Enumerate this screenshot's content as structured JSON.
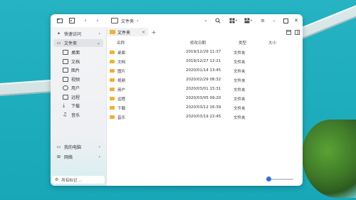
{
  "toolbar": {
    "address_path": "文件夹",
    "address_sep": "›"
  },
  "sidebar": {
    "items": [
      {
        "label": "快速访问",
        "icon": "star-icon"
      },
      {
        "label": "文件夹",
        "icon": "computer-icon"
      },
      {
        "label": "我的电脑",
        "icon": "monitor-icon"
      },
      {
        "label": "网络",
        "icon": "network-icon"
      }
    ],
    "subitems": [
      {
        "label": "桌面",
        "icon": "desktop-icon"
      },
      {
        "label": "文档",
        "icon": "document-icon"
      },
      {
        "label": "图片",
        "icon": "image-icon"
      },
      {
        "label": "视频",
        "icon": "video-icon"
      },
      {
        "label": "用户",
        "icon": "user-icon"
      },
      {
        "label": "远程",
        "icon": "remote-icon"
      },
      {
        "label": "下载",
        "icon": "download-icon"
      },
      {
        "label": "音乐",
        "icon": "music-icon"
      }
    ],
    "tags_label": "所有标记 ..."
  },
  "tabs": [
    {
      "label": "文件夹"
    }
  ],
  "table": {
    "headers": {
      "name": "名称",
      "date": "修改日期",
      "type": "类型",
      "size": "大小"
    },
    "rows": [
      {
        "name": "桌面",
        "date": "2019/12/29 11:37",
        "type": "文件夹"
      },
      {
        "name": "文档",
        "date": "2019/12/27 12:21",
        "type": "文件夹"
      },
      {
        "name": "图片",
        "date": "2020/01/14 13:45",
        "type": "文件夹"
      },
      {
        "name": "视频",
        "date": "2020/02/29 08:32",
        "type": "文件夹"
      },
      {
        "name": "用户",
        "date": "2020/03/01 15:31",
        "type": "文件夹"
      },
      {
        "name": "远程",
        "date": "2020/03/05 09:20",
        "type": "文件夹"
      },
      {
        "name": "下载",
        "date": "2020/03/12 16:39",
        "type": "文件夹"
      },
      {
        "name": "音乐",
        "date": "2020/03/19 22:45",
        "type": "文件夹"
      }
    ]
  },
  "zoom_level": 0.1,
  "colors": {
    "accent": "#2e6fe0",
    "folder": "#f4b030",
    "wallpaper": "#18aebf"
  }
}
